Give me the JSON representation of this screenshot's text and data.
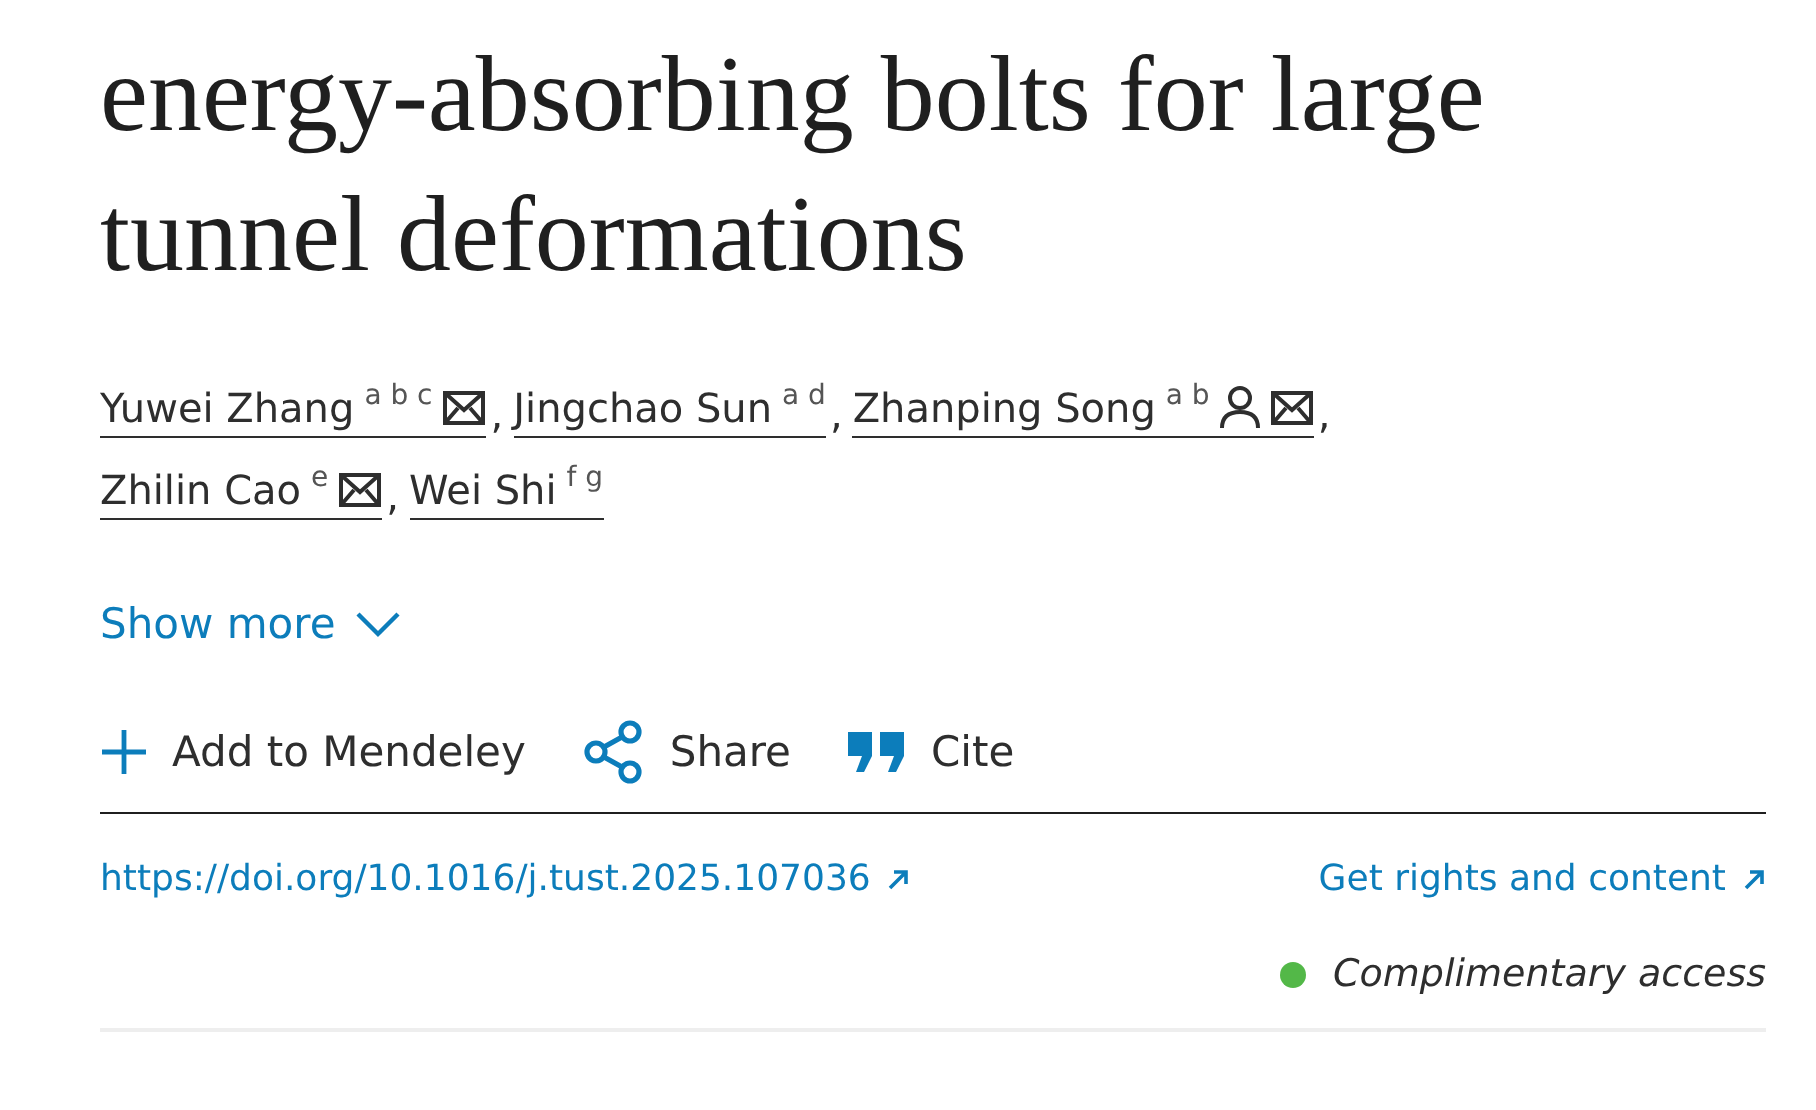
{
  "title": "energy-absorbing bolts for large tunnel deformations",
  "authors": [
    {
      "name": "Yuwei Zhang",
      "affiliations": "a b c",
      "corresponding": false,
      "email": true,
      "separator": ","
    },
    {
      "name": "Jingchao Sun",
      "affiliations": "a d",
      "corresponding": false,
      "email": false,
      "separator": ","
    },
    {
      "name": "Zhanping Song",
      "affiliations": "a b",
      "corresponding": true,
      "email": true,
      "separator": ","
    },
    {
      "name": "Zhilin Cao",
      "affiliations": "e",
      "corresponding": false,
      "email": true,
      "separator": ","
    },
    {
      "name": "Wei Shi",
      "affiliations": "f g",
      "corresponding": false,
      "email": false
    }
  ],
  "show_more": "Show more",
  "actions": [
    {
      "kind": "add",
      "label": "Add to Mendeley"
    },
    {
      "kind": "share",
      "label": "Share"
    },
    {
      "kind": "cite",
      "label": "Cite"
    }
  ],
  "doi": "https://doi.org/10.1016/j.tust.2025.107036",
  "rights": "Get rights and content",
  "access": "Complimentary access"
}
